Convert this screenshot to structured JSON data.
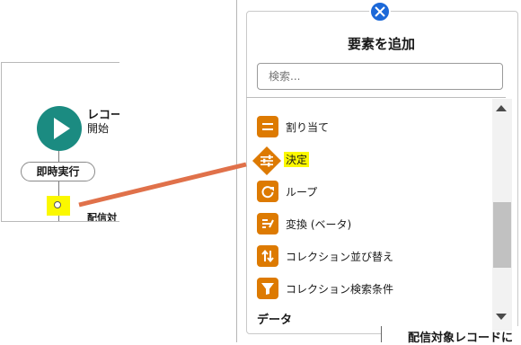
{
  "flow": {
    "start_title": "レコー",
    "start_subtitle": "開始",
    "run_button_label": "即時実行",
    "target_label": "配信対"
  },
  "panel": {
    "title": "要素を追加",
    "search_placeholder": "検索...",
    "items": [
      {
        "label": "割り当て",
        "icon": "assignment-icon"
      },
      {
        "label": "決定",
        "icon": "decision-icon"
      },
      {
        "label": "ループ",
        "icon": "loop-icon"
      },
      {
        "label": "変換 (ベータ)",
        "icon": "transform-icon"
      },
      {
        "label": "コレクション並び替え",
        "icon": "sort-icon"
      },
      {
        "label": "コレクション検索条件",
        "icon": "filter-icon"
      }
    ],
    "section_data": "データ",
    "background_text": "配信対象レコードに"
  },
  "colors": {
    "accent_orange": "#dd7a01",
    "start_teal": "#1b8b81",
    "close_blue": "#1b68d8",
    "highlight_yellow": "#fbf800",
    "connector_orange": "#e0714a"
  }
}
